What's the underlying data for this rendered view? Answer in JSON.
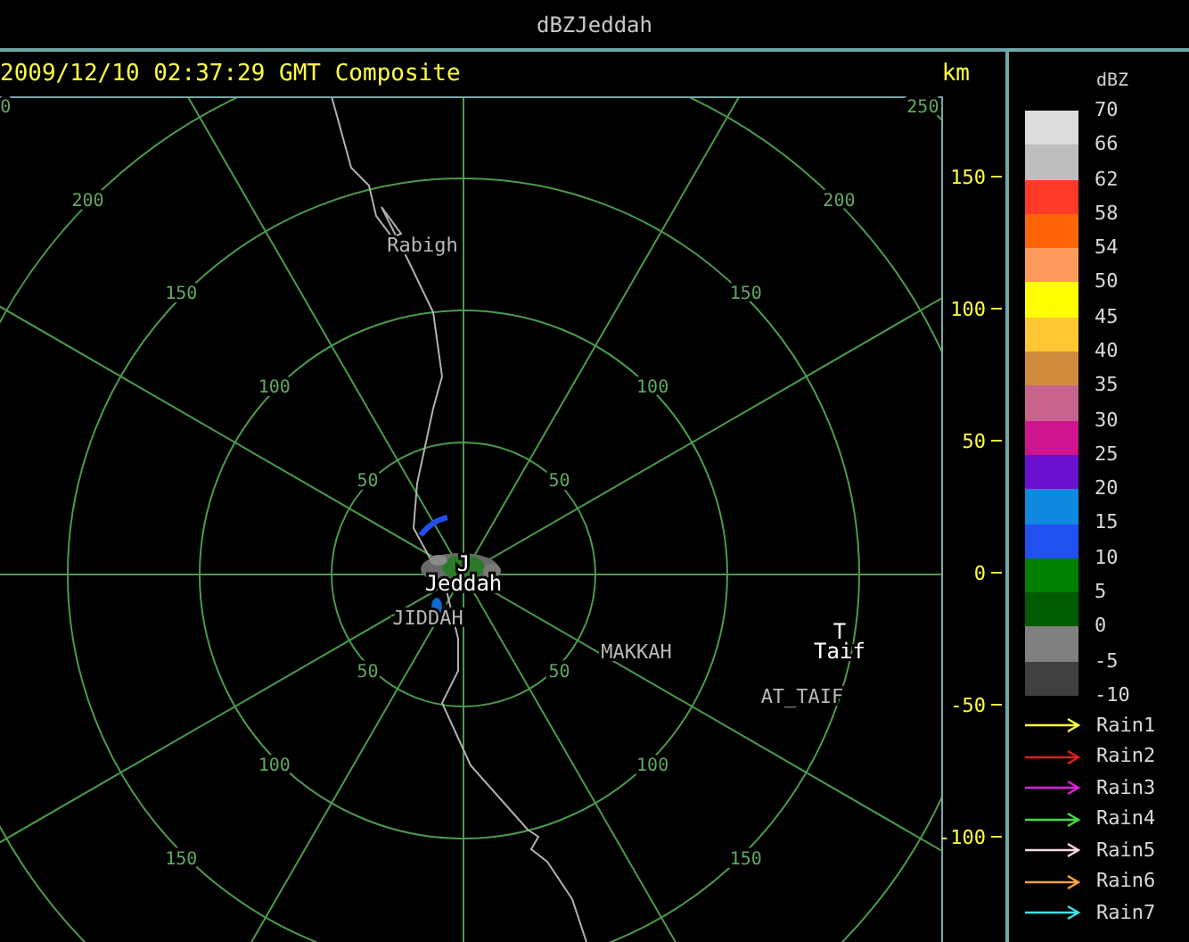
{
  "window": {
    "title": "dBZJeddah"
  },
  "header": {
    "timestamp": "2009/12/10 02:37:29 GMT Composite",
    "unit": "km"
  },
  "range_rings": [
    {
      "nw": "0",
      "ne": "250"
    },
    {
      "nw": "200",
      "ne": "200"
    },
    {
      "nw": "150",
      "ne": "150",
      "sw": "150",
      "se": "150"
    },
    {
      "nw": "100",
      "ne": "100",
      "sw": "100",
      "se": "100"
    },
    {
      "nw": "50",
      "ne": "50",
      "sw": "50",
      "se": "50"
    }
  ],
  "y_axis": {
    "labels": [
      "150",
      "100",
      "50",
      "0",
      "-50",
      "-100"
    ]
  },
  "places": [
    {
      "kind": "city",
      "name": "Rabigh"
    },
    {
      "kind": "site",
      "name": "Jeddah",
      "marker": "J"
    },
    {
      "kind": "city",
      "name": "JIDDAH"
    },
    {
      "kind": "city",
      "name": "MAKKAH"
    },
    {
      "kind": "site",
      "name": "Taif",
      "marker": "T"
    },
    {
      "kind": "city",
      "name": "AT_TAIF"
    }
  ],
  "legend": {
    "title": "dBZ",
    "bands": [
      {
        "color": "#dcdcdc"
      },
      {
        "color": "#bebebe"
      },
      {
        "color": "#ff3a28"
      },
      {
        "color": "#ff6408"
      },
      {
        "color": "#ff9a5c"
      },
      {
        "color": "#ffff00"
      },
      {
        "color": "#ffc832"
      },
      {
        "color": "#d08c3c"
      },
      {
        "color": "#c8648c"
      },
      {
        "color": "#d01490"
      },
      {
        "color": "#6c10d0"
      },
      {
        "color": "#1088e0"
      },
      {
        "color": "#2050f0"
      },
      {
        "color": "#008000"
      },
      {
        "color": "#005c00"
      },
      {
        "color": "#808080"
      },
      {
        "color": "#404040"
      }
    ],
    "labels": [
      "70",
      "66",
      "62",
      "58",
      "54",
      "50",
      "45",
      "40",
      "35",
      "30",
      "25",
      "20",
      "15",
      "10",
      "5",
      "0",
      "-5",
      "-10"
    ],
    "tracks": [
      {
        "name": "Rain1",
        "color": "#ffff40"
      },
      {
        "name": "Rain2",
        "color": "#e02020"
      },
      {
        "name": "Rain3",
        "color": "#e020e0"
      },
      {
        "name": "Rain4",
        "color": "#40e040"
      },
      {
        "name": "Rain5",
        "color": "#ffd8e4"
      },
      {
        "name": "Rain6",
        "color": "#ffa040"
      },
      {
        "name": "Rain7",
        "color": "#40e0e0"
      }
    ]
  }
}
